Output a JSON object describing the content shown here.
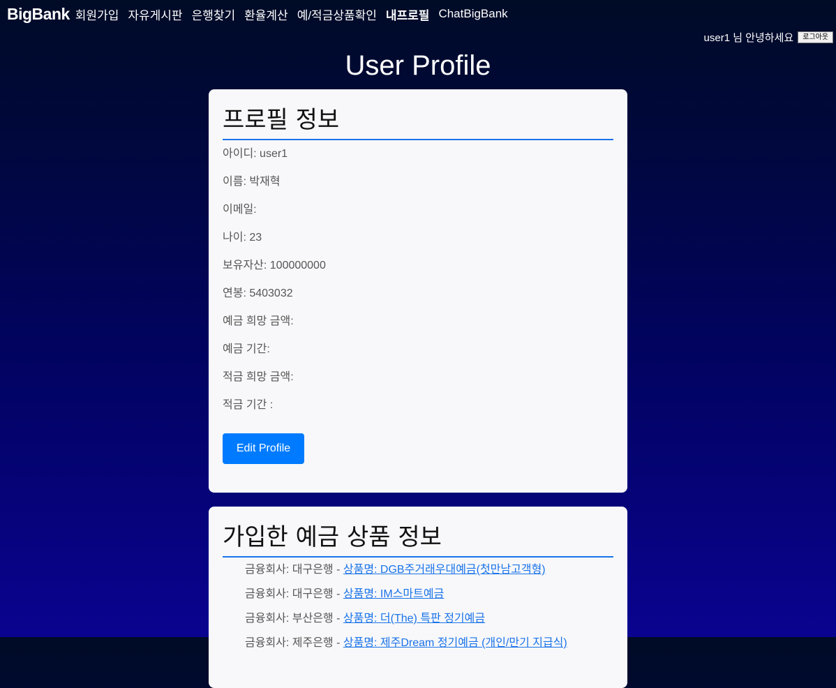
{
  "nav": {
    "logo": "BigBank",
    "links": [
      {
        "label": "회원가입",
        "active": false
      },
      {
        "label": "자유게시판",
        "active": false
      },
      {
        "label": "은행찾기",
        "active": false
      },
      {
        "label": "환율계산",
        "active": false
      },
      {
        "label": "예/적금상품확인",
        "active": false
      },
      {
        "label": "내프로필",
        "active": true
      },
      {
        "label": "ChatBigBank",
        "active": false
      }
    ]
  },
  "userbar": {
    "greeting": "user1 님 안녕하세요",
    "logout_label": "로그아웃"
  },
  "page": {
    "title": "User Profile"
  },
  "profile": {
    "heading": "프로필 정보",
    "fields": [
      "아이디: user1",
      "이름: 박재혁",
      "이메일:",
      "나이: 23",
      "보유자산: 100000000",
      "연봉: 5403032",
      "예금 희망 금액:",
      "예금 기간:",
      "적금 희망 금액:",
      "적금 기간 :"
    ],
    "edit_label": "Edit Profile"
  },
  "products": {
    "heading": "가입한 예금 상품 정보",
    "items": [
      {
        "company": "금융회사: 대구은행 - ",
        "product": "상품명: DGB주거래우대예금(첫만남고객형)"
      },
      {
        "company": "금융회사: 대구은행 - ",
        "product": "상품명: IM스마트예금"
      },
      {
        "company": "금융회사: 부산은행 - ",
        "product": "상품명: 더(The) 특판 정기예금"
      },
      {
        "company": "금융회사: 제주은행 - ",
        "product": "상품명: 제주Dream 정기예금 (개인/만기 지급식)"
      }
    ]
  },
  "colors": {
    "accent": "#1a73e8",
    "button": "#007bff",
    "card": "#f8f8fa"
  }
}
